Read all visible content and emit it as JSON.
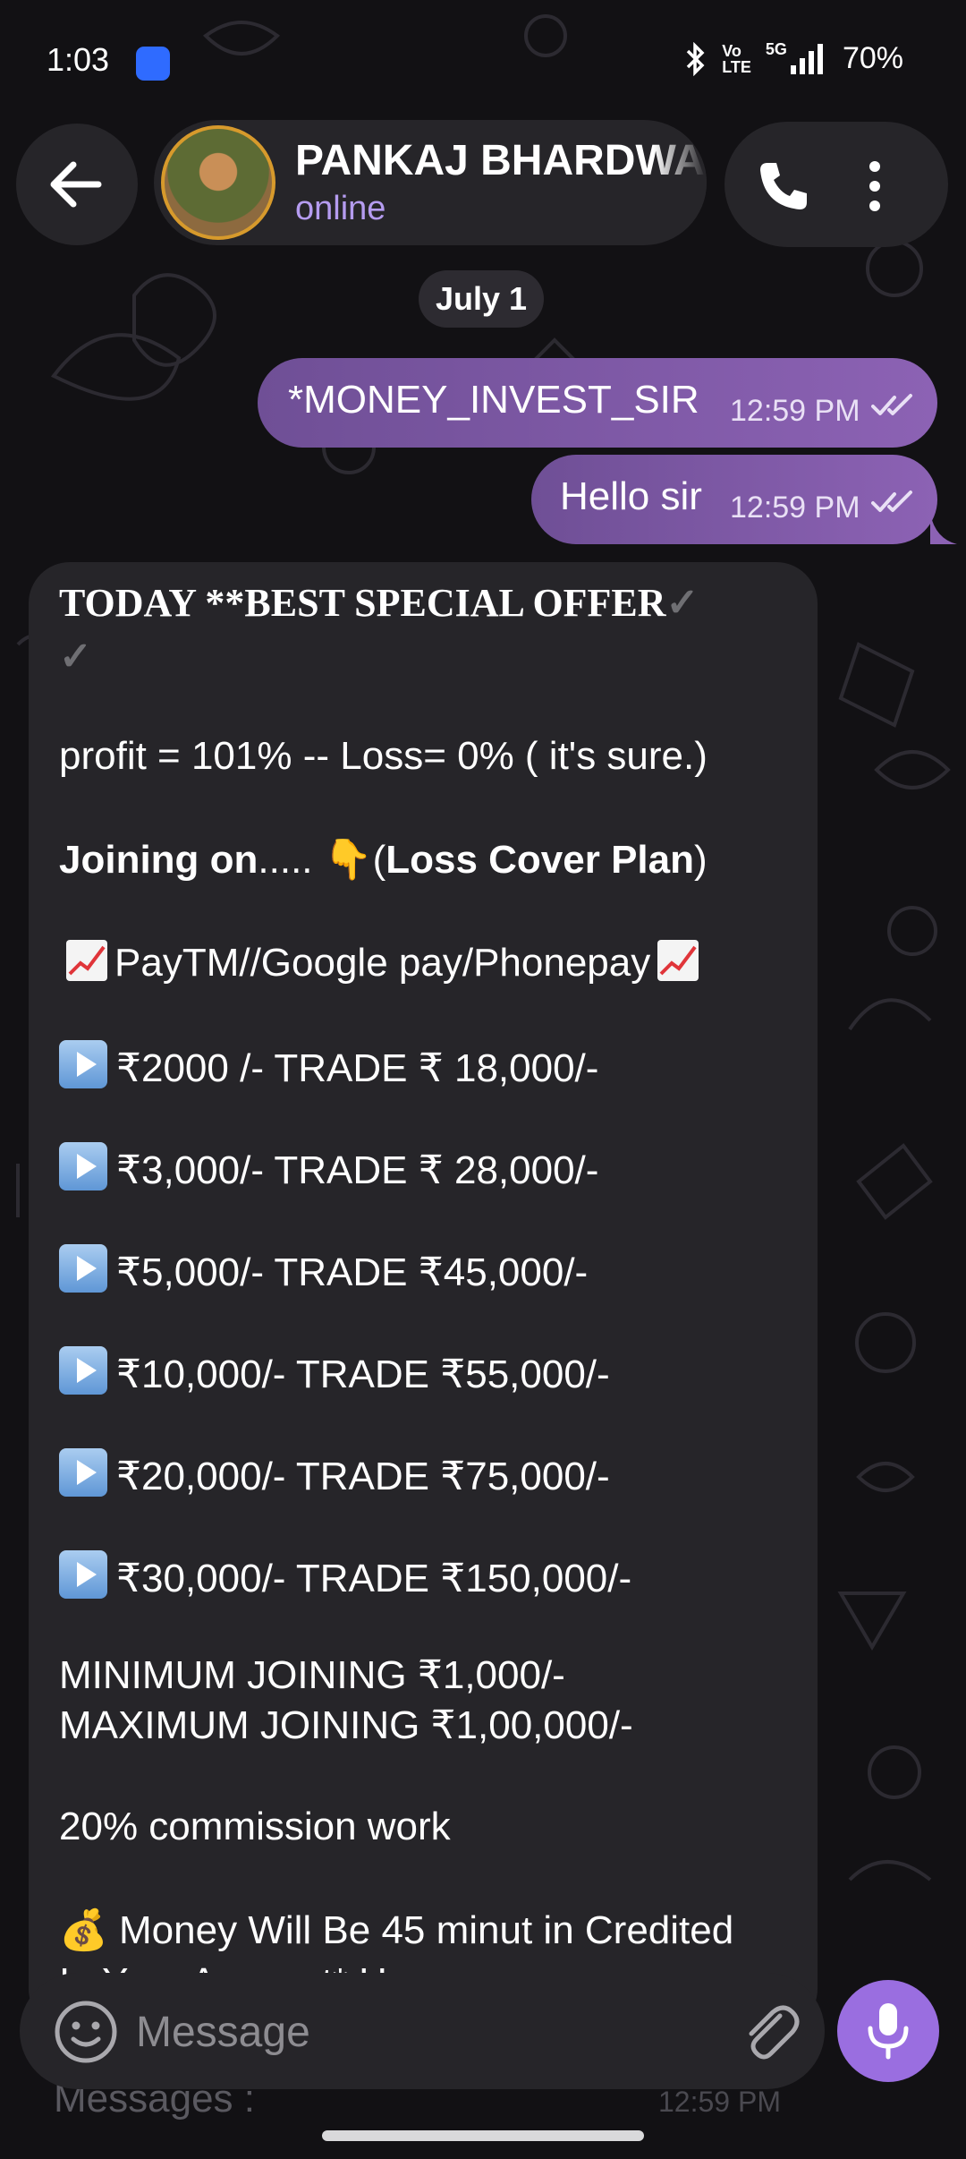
{
  "status_bar": {
    "time": "1:03",
    "battery": "70%",
    "network_volte_top": "Vo",
    "network_volte_bottom": "LTE",
    "network_5g": "5G",
    "icons": [
      "app-notification-icon",
      "bluetooth-icon",
      "volte-icon",
      "signal-icon"
    ]
  },
  "header": {
    "back_icon": "arrow-left-icon",
    "contact_name": "PANKAJ BHARDWAJ",
    "contact_status": "online",
    "call_icon": "phone-icon",
    "more_icon": "more-vertical-icon"
  },
  "date_separator": "July 1",
  "messages_out": [
    {
      "text": "*MONEY_INVEST_SIR",
      "time": "12:59 PM",
      "status": "read"
    },
    {
      "text": "Hello sir",
      "time": "12:59 PM",
      "status": "read"
    }
  ],
  "message_in": {
    "title_text": "TODAY **BEST SPECIAL OFFER",
    "title_check": "✓",
    "title_check2": "✓",
    "profit_line": "profit = 101% -- Loss= 0% ( it's sure.)",
    "joining_bold": "Joining on",
    "joining_dots": "..... ",
    "joining_emoji": "👇",
    "joining_open": "(",
    "joining_plan": "Loss Cover Plan",
    "joining_close": ")",
    "payment_line": "PayTM//Google pay/Phonepay",
    "trades": [
      "₹2000 /- TRADE ₹ 18,000/-",
      "₹3,000/- TRADE ₹ 28,000/-",
      "₹5,000/- TRADE ₹45,000/-",
      "₹10,000/- TRADE ₹55,000/-",
      "₹20,000/- TRADE ₹75,000/-",
      "₹30,000/- TRADE ₹150,000/-"
    ],
    "min_joining": "MINIMUM JOINING ₹1,000/-",
    "max_joining": "MAXIMUM JOINING ₹1,00,000/-",
    "commission": "20%  commission work",
    "money_emoji": "💰",
    "money_line": "Money Will Be 45 minut in Credited",
    "money_line_cut": "In Your Account* Hurry",
    "residual_line": "Messages :",
    "residual_time": "12:59 PM"
  },
  "input": {
    "placeholder": "Message",
    "emoji_icon": "smiley-icon",
    "attach_icon": "paperclip-icon",
    "mic_icon": "microphone-icon"
  },
  "colors": {
    "background": "#121114",
    "surface": "#262529",
    "accent": "#9a6ee0",
    "outgoing_start": "#6f4f96",
    "outgoing_end": "#8c62b4",
    "online": "#b59cf0"
  }
}
